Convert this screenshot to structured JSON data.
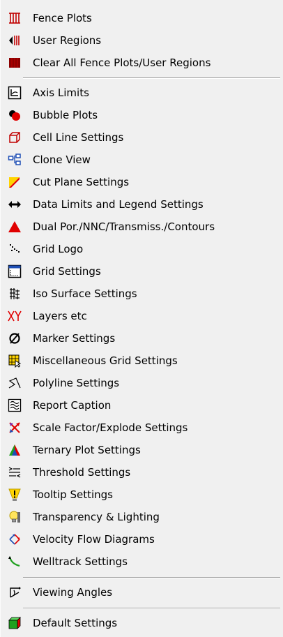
{
  "menu": {
    "items": [
      {
        "label": "Fence Plots",
        "icon": "fence-plots-icon"
      },
      {
        "label": "User Regions",
        "icon": "user-regions-icon"
      },
      {
        "label": "Clear All Fence Plots/User Regions",
        "icon": "clear-fence-icon"
      },
      {
        "label": "Axis Limits",
        "icon": "axis-limits-icon"
      },
      {
        "label": "Bubble Plots",
        "icon": "bubble-plots-icon"
      },
      {
        "label": "Cell Line Settings",
        "icon": "cell-line-icon"
      },
      {
        "label": "Clone View",
        "icon": "clone-view-icon"
      },
      {
        "label": "Cut Plane Settings",
        "icon": "cut-plane-icon"
      },
      {
        "label": "Data Limits and Legend Settings",
        "icon": "data-limits-icon"
      },
      {
        "label": "Dual Por./NNC/Transmiss./Contours",
        "icon": "dual-por-icon"
      },
      {
        "label": "Grid Logo",
        "icon": "grid-logo-icon"
      },
      {
        "label": "Grid Settings",
        "icon": "grid-settings-icon"
      },
      {
        "label": "Iso Surface Settings",
        "icon": "iso-surface-icon"
      },
      {
        "label": "Layers etc",
        "icon": "layers-icon"
      },
      {
        "label": "Marker Settings",
        "icon": "marker-icon"
      },
      {
        "label": "Miscellaneous Grid Settings",
        "icon": "misc-grid-icon"
      },
      {
        "label": "Polyline Settings",
        "icon": "polyline-icon"
      },
      {
        "label": "Report Caption",
        "icon": "report-caption-icon"
      },
      {
        "label": "Scale Factor/Explode Settings",
        "icon": "scale-factor-icon"
      },
      {
        "label": "Ternary Plot Settings",
        "icon": "ternary-plot-icon"
      },
      {
        "label": "Threshold Settings",
        "icon": "threshold-icon"
      },
      {
        "label": "Tooltip Settings",
        "icon": "tooltip-icon"
      },
      {
        "label": "Transparency & Lighting",
        "icon": "transparency-icon"
      },
      {
        "label": "Velocity Flow Diagrams",
        "icon": "velocity-flow-icon"
      },
      {
        "label": "Welltrack Settings",
        "icon": "welltrack-icon"
      },
      {
        "label": "Viewing Angles",
        "icon": "viewing-angles-icon"
      },
      {
        "label": "Default Settings",
        "icon": "default-settings-icon"
      }
    ]
  },
  "colors": {
    "menu_background": "#f0f0f0",
    "separator": "#a0a0a0"
  }
}
